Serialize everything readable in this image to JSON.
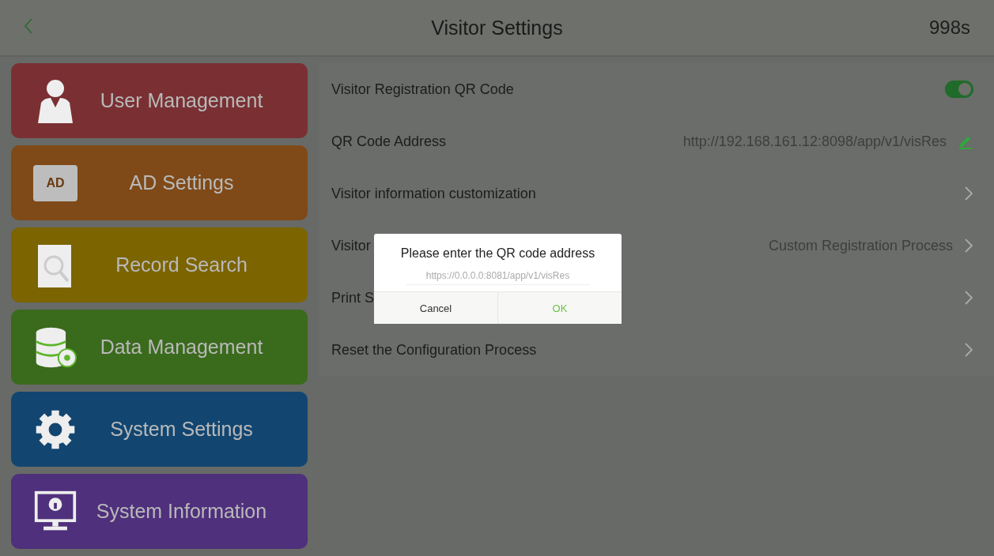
{
  "header": {
    "title": "Visitor Settings",
    "countdown": "998s"
  },
  "sidebar": {
    "items": [
      {
        "label": "User Management",
        "color": "#7a3033"
      },
      {
        "label": "AD Settings",
        "color": "#7f4a18",
        "icon_text": "AD"
      },
      {
        "label": "Record Search",
        "color": "#7c6400"
      },
      {
        "label": "Data Management",
        "color": "#3a6a1c"
      },
      {
        "label": "System Settings",
        "color": "#124671"
      },
      {
        "label": "System Information",
        "color": "#4f307c"
      }
    ]
  },
  "settings": [
    {
      "kind": "toggle",
      "label": "Visitor Registration QR Code",
      "on": true
    },
    {
      "kind": "edit",
      "label": "QR Code Address",
      "value": "http://192.168.161.12:8098/app/v1/visRes"
    },
    {
      "kind": "link",
      "label": "Visitor information customization"
    },
    {
      "kind": "link",
      "label": "Visitor",
      "value": "Custom Registration Process"
    },
    {
      "kind": "link",
      "label": "Print S"
    },
    {
      "kind": "link",
      "label": "Reset the Configuration Process"
    }
  ],
  "dialog": {
    "title": "Please enter the QR code address",
    "placeholder": "https://0.0.0.0:8081/app/v1/visRes",
    "buttons": [
      {
        "label": "Cancel",
        "kind": "cancel"
      },
      {
        "label": "OK",
        "kind": "ok"
      }
    ]
  }
}
